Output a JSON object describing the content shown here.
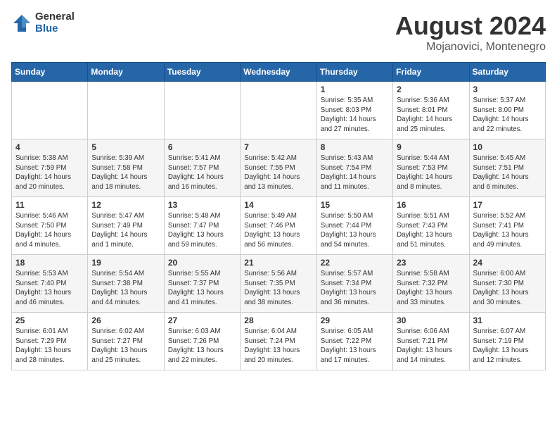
{
  "logo": {
    "general": "General",
    "blue": "Blue"
  },
  "title": {
    "month_year": "August 2024",
    "location": "Mojanovici, Montenegro"
  },
  "days_of_week": [
    "Sunday",
    "Monday",
    "Tuesday",
    "Wednesday",
    "Thursday",
    "Friday",
    "Saturday"
  ],
  "weeks": [
    [
      {
        "day": "",
        "info": ""
      },
      {
        "day": "",
        "info": ""
      },
      {
        "day": "",
        "info": ""
      },
      {
        "day": "",
        "info": ""
      },
      {
        "day": "1",
        "info": "Sunrise: 5:35 AM\nSunset: 8:03 PM\nDaylight: 14 hours and 27 minutes."
      },
      {
        "day": "2",
        "info": "Sunrise: 5:36 AM\nSunset: 8:01 PM\nDaylight: 14 hours and 25 minutes."
      },
      {
        "day": "3",
        "info": "Sunrise: 5:37 AM\nSunset: 8:00 PM\nDaylight: 14 hours and 22 minutes."
      }
    ],
    [
      {
        "day": "4",
        "info": "Sunrise: 5:38 AM\nSunset: 7:59 PM\nDaylight: 14 hours and 20 minutes."
      },
      {
        "day": "5",
        "info": "Sunrise: 5:39 AM\nSunset: 7:58 PM\nDaylight: 14 hours and 18 minutes."
      },
      {
        "day": "6",
        "info": "Sunrise: 5:41 AM\nSunset: 7:57 PM\nDaylight: 14 hours and 16 minutes."
      },
      {
        "day": "7",
        "info": "Sunrise: 5:42 AM\nSunset: 7:55 PM\nDaylight: 14 hours and 13 minutes."
      },
      {
        "day": "8",
        "info": "Sunrise: 5:43 AM\nSunset: 7:54 PM\nDaylight: 14 hours and 11 minutes."
      },
      {
        "day": "9",
        "info": "Sunrise: 5:44 AM\nSunset: 7:53 PM\nDaylight: 14 hours and 8 minutes."
      },
      {
        "day": "10",
        "info": "Sunrise: 5:45 AM\nSunset: 7:51 PM\nDaylight: 14 hours and 6 minutes."
      }
    ],
    [
      {
        "day": "11",
        "info": "Sunrise: 5:46 AM\nSunset: 7:50 PM\nDaylight: 14 hours and 4 minutes."
      },
      {
        "day": "12",
        "info": "Sunrise: 5:47 AM\nSunset: 7:49 PM\nDaylight: 14 hours and 1 minute."
      },
      {
        "day": "13",
        "info": "Sunrise: 5:48 AM\nSunset: 7:47 PM\nDaylight: 13 hours and 59 minutes."
      },
      {
        "day": "14",
        "info": "Sunrise: 5:49 AM\nSunset: 7:46 PM\nDaylight: 13 hours and 56 minutes."
      },
      {
        "day": "15",
        "info": "Sunrise: 5:50 AM\nSunset: 7:44 PM\nDaylight: 13 hours and 54 minutes."
      },
      {
        "day": "16",
        "info": "Sunrise: 5:51 AM\nSunset: 7:43 PM\nDaylight: 13 hours and 51 minutes."
      },
      {
        "day": "17",
        "info": "Sunrise: 5:52 AM\nSunset: 7:41 PM\nDaylight: 13 hours and 49 minutes."
      }
    ],
    [
      {
        "day": "18",
        "info": "Sunrise: 5:53 AM\nSunset: 7:40 PM\nDaylight: 13 hours and 46 minutes."
      },
      {
        "day": "19",
        "info": "Sunrise: 5:54 AM\nSunset: 7:38 PM\nDaylight: 13 hours and 44 minutes."
      },
      {
        "day": "20",
        "info": "Sunrise: 5:55 AM\nSunset: 7:37 PM\nDaylight: 13 hours and 41 minutes."
      },
      {
        "day": "21",
        "info": "Sunrise: 5:56 AM\nSunset: 7:35 PM\nDaylight: 13 hours and 38 minutes."
      },
      {
        "day": "22",
        "info": "Sunrise: 5:57 AM\nSunset: 7:34 PM\nDaylight: 13 hours and 36 minutes."
      },
      {
        "day": "23",
        "info": "Sunrise: 5:58 AM\nSunset: 7:32 PM\nDaylight: 13 hours and 33 minutes."
      },
      {
        "day": "24",
        "info": "Sunrise: 6:00 AM\nSunset: 7:30 PM\nDaylight: 13 hours and 30 minutes."
      }
    ],
    [
      {
        "day": "25",
        "info": "Sunrise: 6:01 AM\nSunset: 7:29 PM\nDaylight: 13 hours and 28 minutes."
      },
      {
        "day": "26",
        "info": "Sunrise: 6:02 AM\nSunset: 7:27 PM\nDaylight: 13 hours and 25 minutes."
      },
      {
        "day": "27",
        "info": "Sunrise: 6:03 AM\nSunset: 7:26 PM\nDaylight: 13 hours and 22 minutes."
      },
      {
        "day": "28",
        "info": "Sunrise: 6:04 AM\nSunset: 7:24 PM\nDaylight: 13 hours and 20 minutes."
      },
      {
        "day": "29",
        "info": "Sunrise: 6:05 AM\nSunset: 7:22 PM\nDaylight: 13 hours and 17 minutes."
      },
      {
        "day": "30",
        "info": "Sunrise: 6:06 AM\nSunset: 7:21 PM\nDaylight: 13 hours and 14 minutes."
      },
      {
        "day": "31",
        "info": "Sunrise: 6:07 AM\nSunset: 7:19 PM\nDaylight: 13 hours and 12 minutes."
      }
    ]
  ]
}
